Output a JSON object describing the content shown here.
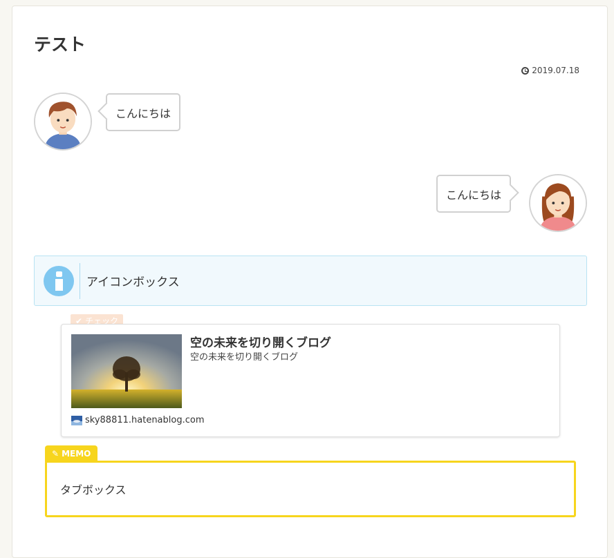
{
  "post": {
    "title": "テスト",
    "date": "2019.07.18"
  },
  "balloons": [
    {
      "side": "left",
      "speaker": "boy",
      "text": "こんにちは"
    },
    {
      "side": "right",
      "speaker": "girl",
      "text": "こんにちは"
    }
  ],
  "icon_box": {
    "icon": "info-icon",
    "text": "アイコンボックス",
    "colors": {
      "background": "#f1f9fd",
      "border": "#b8e3f3",
      "icon": "#7fc7f0"
    }
  },
  "blog_card": {
    "tag": "チェック",
    "title": "空の未来を切り開くブログ",
    "description": "空の未来を切り開くブログ",
    "domain": "sky88811.hatenablog.com"
  },
  "tab_box": {
    "label": "MEMO",
    "text": "タブボックス",
    "color": "#f7d51d"
  }
}
